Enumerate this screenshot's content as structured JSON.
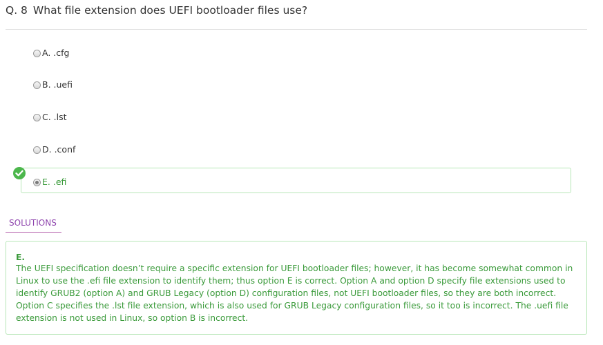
{
  "question": {
    "number": "Q. 8",
    "text": "What file extension does UEFI bootloader files use?"
  },
  "options": [
    {
      "label": "A. .cfg",
      "selected": false,
      "correct": false
    },
    {
      "label": "B. .uefi",
      "selected": false,
      "correct": false
    },
    {
      "label": "C. .lst",
      "selected": false,
      "correct": false
    },
    {
      "label": "D. .conf",
      "selected": false,
      "correct": false
    },
    {
      "label": "E. .efi",
      "selected": true,
      "correct": true
    }
  ],
  "solutions": {
    "tab_label": "SOLUTIONS",
    "answer": "E.",
    "explanation": "The UEFI specification doesn’t require a specific extension for UEFI bootloader files; however, it has become somewhat common in Linux to use the .efi file extension to identify them; thus option E is correct. Option A and option D specify file extensions used to identify GRUB2 (option A) and GRUB Legacy (option D) configuration files, not UEFI bootloader files, so they are both incorrect. Option C specifies the .lst file extension, which is also used for GRUB Legacy configuration files, so it too is incorrect. The .uefi file extension is not used in Linux, so option B is incorrect."
  },
  "colors": {
    "correct": "#3a9a3a",
    "correct_border": "#b6e6b6",
    "badge": "#4cb74c",
    "solutions_tab": "#8e44ad"
  },
  "icons": {
    "correct_badge": "check-circle-icon"
  }
}
